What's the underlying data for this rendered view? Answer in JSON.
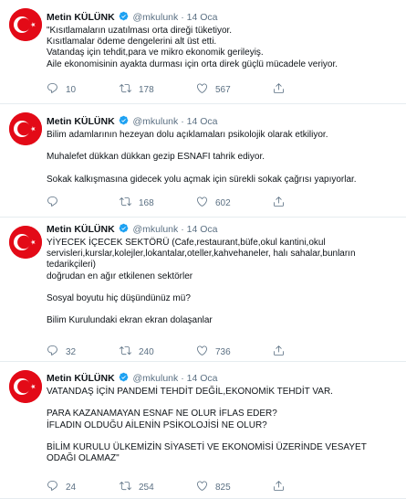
{
  "colors": {
    "text": "#0f1419",
    "secondary": "#5b7083",
    "verified": "#1da1f2",
    "avatar_bg": "#e30a17",
    "divider": "#e6ecf0"
  },
  "icons": {
    "avatar": "turkish-flag-avatar",
    "verified": "verified-badge-icon",
    "reply": "reply-icon",
    "retweet": "retweet-icon",
    "like": "heart-icon",
    "share": "share-icon"
  },
  "tweets": [
    {
      "author": "Metin KÜLÜNK",
      "handle": "@mkulunk",
      "dot": "·",
      "time": "14 Oca",
      "lines": [
        "\"Kısıtlamaların uzatılması orta direği tüketiyor.",
        "Kısıtlamalar ödeme dengelerini alt üst etti.",
        "Vatandaş için tehdit,para ve mikro ekonomik gerileyiş.",
        "Aile ekonomisinin ayakta durması için orta direk güçlü mücadele veriyor."
      ],
      "replies": "10",
      "retweets": "178",
      "likes": "567"
    },
    {
      "author": "Metin KÜLÜNK",
      "handle": "@mkulunk",
      "dot": "·",
      "time": "14 Oca",
      "lines": [
        "Bilim adamlarının hezeyan dolu açıklamaları psikolojik olarak etkiliyor.",
        "",
        "Muhalefet dükkan dükkan gezip ESNAFI tahrik ediyor.",
        "",
        "Sokak kalkışmasına gidecek yolu açmak için sürekli sokak çağrısı yapıyorlar."
      ],
      "replies": "",
      "retweets": "168",
      "likes": "602"
    },
    {
      "author": "Metin KÜLÜNK",
      "handle": "@mkulunk",
      "dot": "·",
      "time": "14 Oca",
      "lines": [
        "YİYECEK İÇECEK SEKTÖRÜ (Cafe,restaurant,büfe,okul kantini,okul",
        "servisleri,kurslar,kolejler,lokantalar,oteller,kahvehaneler, halı sahalar,bunların",
        "tedarikçileri)",
        "doğrudan en ağır etkilenen sektörler",
        "",
        "Sosyal boyutu hiç düşündünüz mü?",
        "",
        "Bilim Kurulundaki ekran ekran dolaşanlar"
      ],
      "replies": "32",
      "retweets": "240",
      "likes": "736"
    },
    {
      "author": "Metin KÜLÜNK",
      "handle": "@mkulunk",
      "dot": "·",
      "time": "14 Oca",
      "lines": [
        "VATANDAŞ İÇİN PANDEMİ TEHDİT DEĞİL,EKONOMİK TEHDİT VAR.",
        "",
        "PARA KAZANAMAYAN ESNAF NE OLUR İFLAS EDER?",
        "İFLADIN OLDUĞU AİLENİN PSİKOLOJİSİ NE OLUR?",
        "",
        "BİLİM KURULU ÜLKEMİZİN SİYASETİ VE EKONOMİSİ ÜZERİNDE VESAYET",
        "ODAĞI OLAMAZ\""
      ],
      "replies": "24",
      "retweets": "254",
      "likes": "825"
    }
  ]
}
